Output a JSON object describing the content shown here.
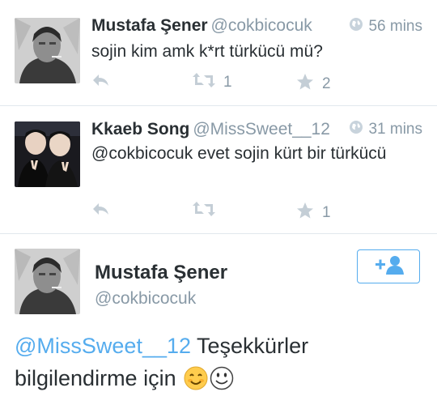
{
  "tweets": [
    {
      "name": "Mustafa Şener",
      "handle": "@cokbicocuk",
      "time": "56 mins",
      "text": "sojin kim amk k*rt türkücü mü?",
      "retweets": "1",
      "favorites": "2"
    },
    {
      "name": "Kkaeb Song",
      "handle": "@MissSweet__12",
      "time": "31 mins",
      "text": "@cokbicocuk evet sojin kürt bir türkücü",
      "retweets": "",
      "favorites": "1"
    }
  ],
  "main_tweet": {
    "name": "Mustafa Şener",
    "handle": "@cokbicocuk",
    "mention": "@MissSweet__12",
    "text": " Teşekkürler bilgilendirme için "
  },
  "colors": {
    "accent": "#55acee",
    "muted": "#8899a6",
    "text": "#292f33",
    "divider": "#e1e8ed"
  },
  "icons": [
    "globe-icon",
    "reply-icon",
    "retweet-icon",
    "favorite-icon",
    "follow-icon",
    "smile-emoji-icon",
    "grin-emoji-icon"
  ]
}
